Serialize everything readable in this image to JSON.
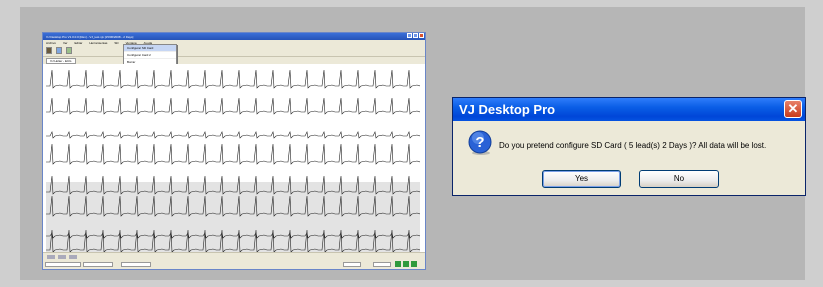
{
  "app_window": {
    "title": "VJ Desktop Pro V1.0.0.0 [Rev] - VJ_test.vjx [15/06/2008 - 2 Days]",
    "menu": [
      "Archivo",
      "Ver",
      "Editar",
      "Herramientas",
      "SD",
      "Ventana",
      "Ayuda"
    ],
    "dropdown_items": [
      "Configurar SD Card",
      "Configurar Card 2",
      "Borrar",
      "Importar"
    ],
    "tab_label": "VJ Holter - ECG",
    "status": {
      "left_label": "Listo",
      "mid_label": "SD Card",
      "zoom_label": "25 mm/s"
    }
  },
  "dialog": {
    "title": "VJ Desktop Pro",
    "message": "Do you pretend configure SD Card ( 5 lead(s)  2 Days )? All data will be lost.",
    "yes_label": "Yes",
    "no_label": "No",
    "icon": "question-icon",
    "close_icon": "close-icon"
  },
  "colors": {
    "dialog_title_bar": "#0a5ee6",
    "close_button": "#c83b1c",
    "panel_bg": "#b6b6b6",
    "page_bg": "#cfcfcf"
  }
}
